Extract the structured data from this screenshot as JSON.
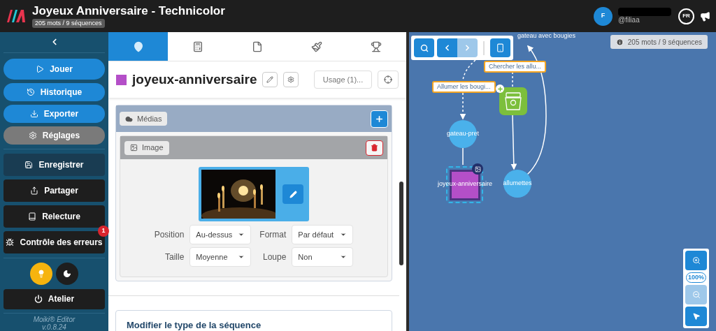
{
  "header": {
    "title": "Joyeux Anniversaire - Technicolor",
    "stats": "205 mots / 9 séquences",
    "user": {
      "initial": "F",
      "handle": "@filiaa"
    },
    "language": "FR"
  },
  "sidebar": {
    "buttons": [
      {
        "label": "Jouer",
        "kind": "primary",
        "disabled": false
      },
      {
        "label": "Historique",
        "kind": "primary",
        "disabled": false
      },
      {
        "label": "Exporter",
        "kind": "primary",
        "disabled": false
      },
      {
        "label": "Réglages",
        "kind": "secondary",
        "disabled": false
      },
      {
        "label": "Enregistrer",
        "kind": "dark",
        "disabled": true
      },
      {
        "label": "Partager",
        "kind": "dark",
        "disabled": false
      },
      {
        "label": "Relecture",
        "kind": "dark",
        "disabled": false
      },
      {
        "label": "Contrôle des erreurs",
        "kind": "dark",
        "disabled": false,
        "badge": "1"
      }
    ],
    "theme": [
      {
        "selected": true
      },
      {
        "selected": false
      }
    ],
    "workshop": "Atelier",
    "version": [
      "Moiki® Editor",
      "v.0.8.24"
    ]
  },
  "editor": {
    "tabs": [
      {
        "selected": true
      },
      {
        "selected": false
      },
      {
        "selected": false
      },
      {
        "selected": false
      },
      {
        "selected": false
      }
    ],
    "sequence": {
      "name": "joyeux-anniversaire",
      "color": "#b44fc8",
      "usage": "Usage (1)..."
    },
    "media": {
      "title": "Médias",
      "item": {
        "title": "Image",
        "fields": [
          {
            "label": "Position",
            "value": "Au-dessus"
          },
          {
            "label": "Format",
            "value": "Par défaut"
          },
          {
            "label": "Taille",
            "value": "Moyenne"
          },
          {
            "label": "Loupe",
            "value": "Non"
          }
        ]
      }
    },
    "section": "Modifier le type de la séquence"
  },
  "graph": {
    "stats": "205 mots / 9 séquences",
    "top_node": "gateau avec bougies",
    "choices": [
      "Allumer les bougi...",
      "Chercher les allu..."
    ],
    "nodes": [
      {
        "label": "gateau-pret",
        "kind": "circle",
        "selected": false
      },
      {
        "label": "joyeux-anniversaire",
        "kind": "square",
        "selected": true
      },
      {
        "label": "allumettes",
        "kind": "circle",
        "selected": false
      }
    ],
    "zoom": "100%"
  }
}
